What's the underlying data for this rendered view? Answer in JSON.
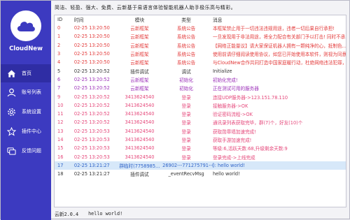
{
  "app": {
    "name": "CloudNew"
  },
  "sidebar": {
    "items": [
      {
        "label": "首页",
        "icon": "home-icon"
      },
      {
        "label": "账号列表",
        "icon": "user-icon"
      },
      {
        "label": "系统设置",
        "icon": "gear-icon"
      },
      {
        "label": "插件中心",
        "icon": "star-icon"
      },
      {
        "label": "反馈问题",
        "icon": "feedback-icon"
      }
    ]
  },
  "banner": {
    "text": "简洁、轻盈、强大、免费、云新基于易语言体验智能机器人助手极乐高与精彩。"
  },
  "table": {
    "headers": {
      "id": "ID",
      "time": "时间",
      "module": "模块",
      "type": "类型",
      "message": "消息"
    },
    "rows": [
      {
        "id": "0",
        "time": "02-25  13:20:50",
        "module": "云新框架",
        "type": "系统公告",
        "message": "本框架禁止用于一切违法违规用途，违者一切后果自行承担!",
        "color": "#e33b3b"
      },
      {
        "id": "1",
        "time": "02-25  13:20:50",
        "module": "云新框架",
        "type": "系统公告",
        "message": "一旦发现用于非法用途，将全力配合有关部门予以打击! 同时不承...",
        "color": "#e33b3b"
      },
      {
        "id": "2",
        "time": "02-25  13:20:50",
        "module": "云新框架",
        "type": "系统公告",
        "message": "【网络正能量议】请大家保证机器人拥有一颗纯净的心，抵制色...",
        "color": "#e33b3b"
      },
      {
        "id": "3",
        "time": "02-25  13:20:50",
        "module": "云新框架",
        "type": "系统公告",
        "message": "使用前请仔细阅读使用协议，如您已开始使用本软件，则视为同意...",
        "color": "#e33b3b"
      },
      {
        "id": "4",
        "time": "02-25  13:20:50",
        "module": "云新框架",
        "type": "系统公告",
        "message": "与CloudNew合作共同打造中国家庭暖行动，杜绝网络违法犯罪，共同打...",
        "color": "#e33b3b"
      },
      {
        "id": "5",
        "time": "02-25  13:20:52",
        "module": "插件调试",
        "type": "调试",
        "message": "Initialize",
        "color": "#333333"
      },
      {
        "id": "6",
        "time": "02-25  13:20:52",
        "module": "云新框架",
        "type": "初始化",
        "message": "初始化完成!",
        "color": "#9b2fb8"
      },
      {
        "id": "7",
        "time": "02-25  13:20:52",
        "module": "云新框架",
        "type": "初始化",
        "message": "正在测试可用的服务器",
        "color": "#9b2fb8"
      },
      {
        "id": "9",
        "time": "02-25  13:20:52",
        "module": "3413624540",
        "type": "登录",
        "message": "连接UDP服务器->123.151.78.110",
        "color": "#e5477a"
      },
      {
        "id": "10",
        "time": "02-25  13:20:52",
        "module": "3413624540",
        "type": "登录",
        "message": "接触服务器->OK",
        "color": "#e5477a"
      },
      {
        "id": "11",
        "time": "02-25  13:20:52",
        "module": "3413624540",
        "type": "登录",
        "message": "验证密码流程->OK",
        "color": "#e5477a"
      },
      {
        "id": "12",
        "time": "02-25  13:20:52",
        "module": "3413624540",
        "type": "登录",
        "message": "通讯录列表获取完毕，群(7)个，好友(10)个",
        "color": "#e5477a"
      },
      {
        "id": "13",
        "time": "02-25  13:20:53",
        "module": "3413624540",
        "type": "登录",
        "message": "获取勋章墙加速完成!",
        "color": "#e5477a"
      },
      {
        "id": "14",
        "time": "02-25  13:20:53",
        "module": "3413624540",
        "type": "登录",
        "message": "获取手游加速完成!",
        "color": "#e5477a"
      },
      {
        "id": "15",
        "time": "02-25  13:20:53",
        "module": "3413624540",
        "type": "登录",
        "message": "等级:6,活跃天数:68,升级剩余天数:9",
        "color": "#e5477a"
      },
      {
        "id": "16",
        "time": "02-25  13:20:53",
        "module": "3413624540",
        "type": "登录",
        "message": "登录完成->上线完成",
        "color": "#e5477a"
      },
      {
        "id": "17",
        "time": "02-25  13:21:27",
        "module": "群临时(7758985...",
        "type": "26902---771275791--(",
        "message": "            ): hello world!",
        "color": "#2f63c8",
        "selected": true
      },
      {
        "id": "18",
        "time": "02-25  13:21:27",
        "module": "插件调试",
        "type": "_eventRecvMsg",
        "message": "hello world!",
        "color": "#333333"
      }
    ]
  },
  "statusbar": {
    "version": "云新2.0.4",
    "last_message": "hello world!"
  },
  "colors": {
    "sidebar": "#3c3ac0",
    "sidebar_active": "#2f2da4",
    "selected_row": "#d7e8f9"
  }
}
